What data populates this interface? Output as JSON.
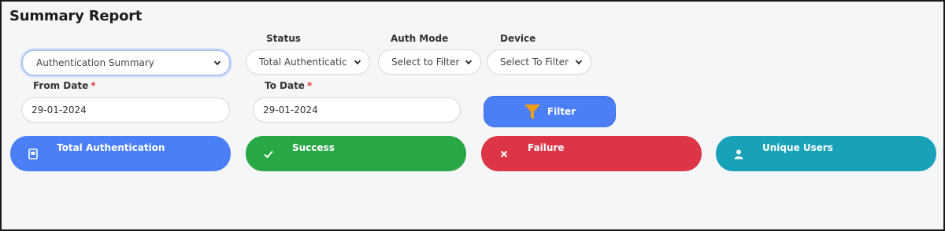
{
  "page": {
    "title": "Summary Report"
  },
  "filters": {
    "report_type": {
      "value": "Authentication Summary"
    },
    "status": {
      "label": "Status",
      "value": "Total Authenticatic"
    },
    "auth_mode": {
      "label": "Auth Mode",
      "value": "Select to Filter"
    },
    "device": {
      "label": "Device",
      "value": "Select To Filter"
    },
    "from_date": {
      "label": "From Date",
      "required_mark": "*",
      "value": "29-01-2024"
    },
    "to_date": {
      "label": "To Date",
      "required_mark": "*",
      "value": "29-01-2024"
    },
    "filter_button": {
      "label": "Filter",
      "icon": "funnel-icon",
      "icon_color": "#f39c12"
    }
  },
  "cards": [
    {
      "label": "Total Authentication",
      "icon": "id-card-icon",
      "color": "#4a7ff7"
    },
    {
      "label": "Success",
      "icon": "check-icon",
      "color": "#28a745"
    },
    {
      "label": "Failure",
      "icon": "close-icon",
      "color": "#dc3545"
    },
    {
      "label": "Unique Users",
      "icon": "user-icon",
      "color": "#17a2b8"
    }
  ]
}
